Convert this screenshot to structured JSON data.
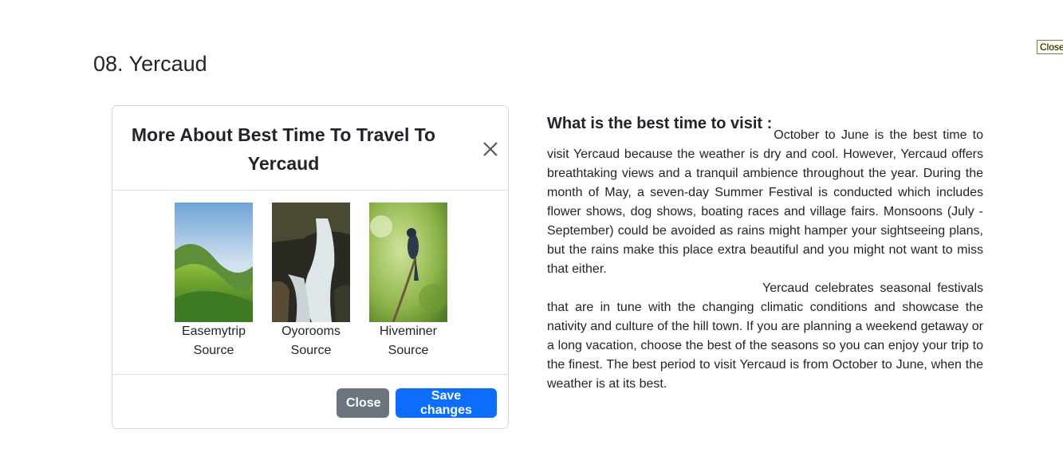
{
  "page": {
    "title": "08. Yercaud"
  },
  "tooltip": {
    "text": "Close"
  },
  "modal": {
    "title": "More About Best Time To Travel To Yercaud",
    "images": [
      {
        "caption_line1": "Easemytrip",
        "caption_line2": "Source",
        "icon": "mountain-landscape-image"
      },
      {
        "caption_line1": "Oyorooms",
        "caption_line2": "Source",
        "icon": "waterfall-image"
      },
      {
        "caption_line1": "Hiveminer",
        "caption_line2": "Source",
        "icon": "bird-image"
      }
    ],
    "close_label": "Close",
    "save_label": "Save changes"
  },
  "article": {
    "heading": "What is the best time to visit :",
    "para1": "October to June is the best time to visit Yercaud because the weather is dry and cool. However, Yercaud offers breathtaking views and a tranquil ambience throughout the year. During the month of May, a seven-day Summer Festival is conducted which includes flower shows, dog shows, boating races and village fairs. Monsoons (July - September) could be avoided as rains might hamper your sightseeing plans, but the rains make this place extra beautiful and you might not want to miss that either.",
    "para2": "Yercaud celebrates seasonal festivals that are in tune with the changing climatic conditions and showcase the nativity and culture of the hill town. If you are planning a weekend getaway or a long vacation, choose the best of the seasons so you can enjoy your trip to the finest. The best period to visit Yercaud is from October to June, when the weather is at its best."
  },
  "colors": {
    "primary_button": "#0d6efd",
    "secondary_button": "#6c757d",
    "text": "#212529"
  }
}
